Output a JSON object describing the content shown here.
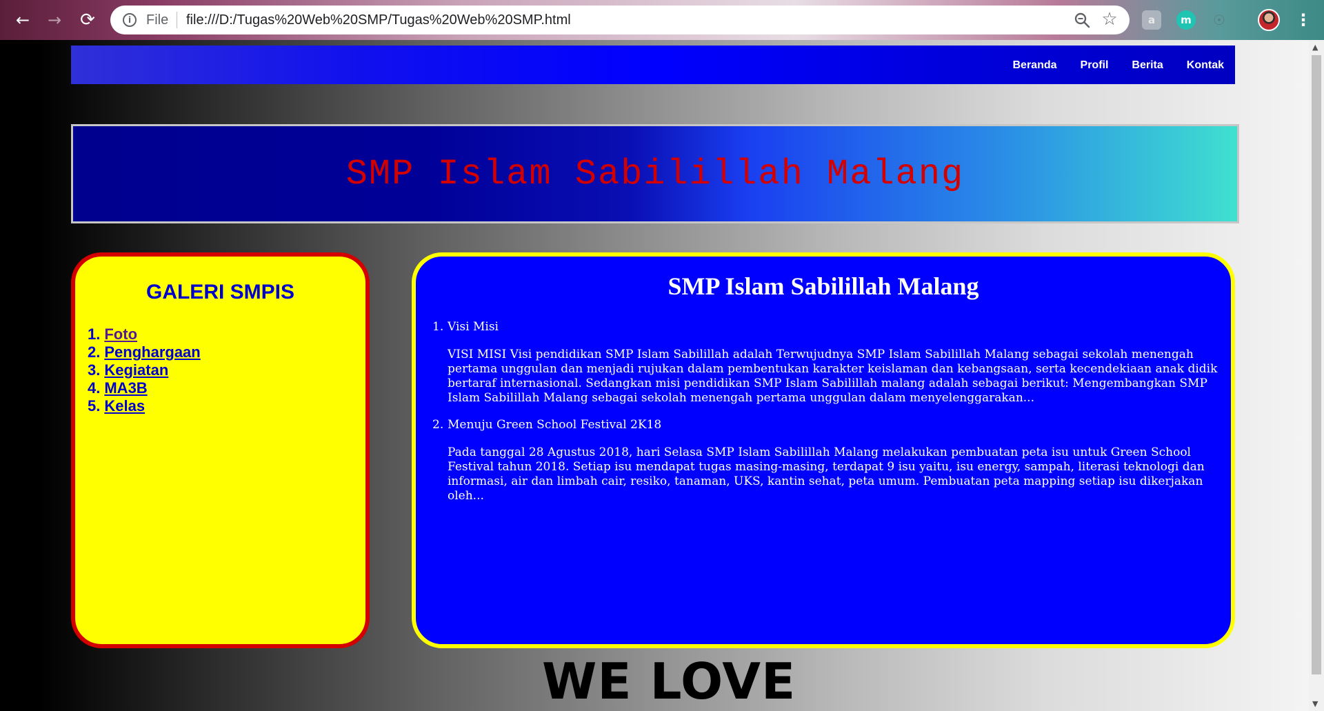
{
  "browser": {
    "back_icon": "←",
    "forward_icon": "→",
    "reload_icon": "⟳",
    "info_icon": "i",
    "scheme_label": "File",
    "url": "file:///D:/Tugas%20Web%20SMP/Tugas%20Web%20SMP.html",
    "star_icon": "☆",
    "extensions": [
      "a",
      "m",
      "☉"
    ],
    "menu_icon": "⋮"
  },
  "nav": {
    "items": [
      "Beranda",
      "Profil",
      "Berita",
      "Kontak"
    ]
  },
  "header": {
    "title": "SMP Islam Sabilillah Malang"
  },
  "gallery": {
    "title": "GALERI SMPIS",
    "items": [
      {
        "num": "1.",
        "label": "Foto"
      },
      {
        "num": "2.",
        "label": "Penghargaan"
      },
      {
        "num": "3.",
        "label": "Kegiatan"
      },
      {
        "num": "4.",
        "label": "MA3B"
      },
      {
        "num": "5.",
        "label": "Kelas"
      }
    ]
  },
  "content": {
    "title": "SMP Islam Sabilillah Malang",
    "articles": [
      {
        "num": "1.",
        "heading": "Visi Misi",
        "body": "VISI MISI Visi pendidikan SMP Islam Sabilillah adalah Terwujudnya SMP Islam Sabilillah Malang sebagai sekolah menengah pertama unggulan dan menjadi rujukan dalam pembentukan karakter keislaman dan kebangsaan, serta kecendekiaan anak didik bertaraf internasional. Sedangkan misi pendidikan SMP Islam Sabilillah malang adalah sebagai berikut: Mengembangkan SMP Islam Sabilillah Malang sebagai sekolah menengah pertama unggulan dalam menyelenggarakan..."
      },
      {
        "num": "2.",
        "heading": "Menuju Green School Festival 2K18",
        "body": "Pada tanggal 28 Agustus 2018, hari Selasa SMP Islam Sabilillah Malang melakukan pembuatan peta isu untuk Green School Festival tahun 2018. Setiap isu mendapat tugas masing-masing, terdapat 9 isu yaitu, isu energy, sampah, literasi teknologi dan informasi, air dan limbah cair, resiko, tanaman, UKS, kantin sehat, peta umum. Pembuatan peta mapping setiap isu dikerjakan oleh..."
      }
    ]
  },
  "footer": {
    "text": "WE LOVE"
  },
  "colors": {
    "nav_bg": "#0000ff",
    "title_red": "#d40000",
    "gallery_bg": "#ffff00",
    "gallery_border": "#d40000",
    "content_bg": "#0000ff",
    "content_border": "#ffff00"
  }
}
